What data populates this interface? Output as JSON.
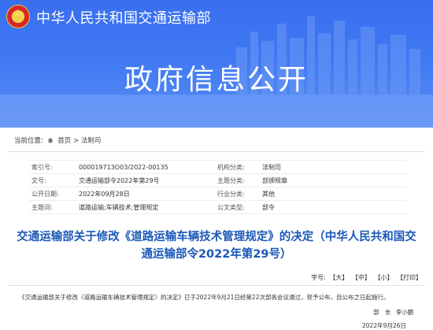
{
  "header": {
    "ministry_name": "中华人民共和国交通运输部",
    "banner_title": "政府信息公开"
  },
  "breadcrumb": {
    "label": "当前位置:",
    "home": "首页",
    "separator": ">",
    "current": "法制司"
  },
  "info": {
    "index_no_label": "索引号:",
    "index_no": "000019713O03/2022-00135",
    "agency_label": "机构分类:",
    "agency": "法制司",
    "doc_no_label": "文号:",
    "doc_no": "交通运输部令2022年第29号",
    "topic_label": "主题分类:",
    "topic": "部颁规章",
    "date_label": "公开日期:",
    "date": "2022年09月28日",
    "industry_label": "行业分类:",
    "industry": "其他",
    "keywords_label": "主题词:",
    "keywords": "道路运输;车辆技术;管理规定",
    "doc_type_label": "公文类型:",
    "doc_type": "部令"
  },
  "article": {
    "title": "交通运输部关于修改《道路运输车辆技术管理规定》的决定（中华人民共和国交通运输部令2022年第29号）",
    "size_label": "字号:",
    "size_large": "【大】",
    "size_medium": "【中】",
    "size_small": "【小】",
    "print": "【打印】",
    "body": "《交通运输部关于修改〈道路运输车辆技术管理规定〉的决定》已于2022年9月21日经第22次部务会议通过，现予公布，自公布之日起施行。",
    "signer_title": "部　长",
    "signer_name": "李小鹏",
    "sign_date": "2022年9月26日"
  },
  "colors": {
    "banner": "#3f78f2",
    "title_blue": "#1b58b8"
  }
}
